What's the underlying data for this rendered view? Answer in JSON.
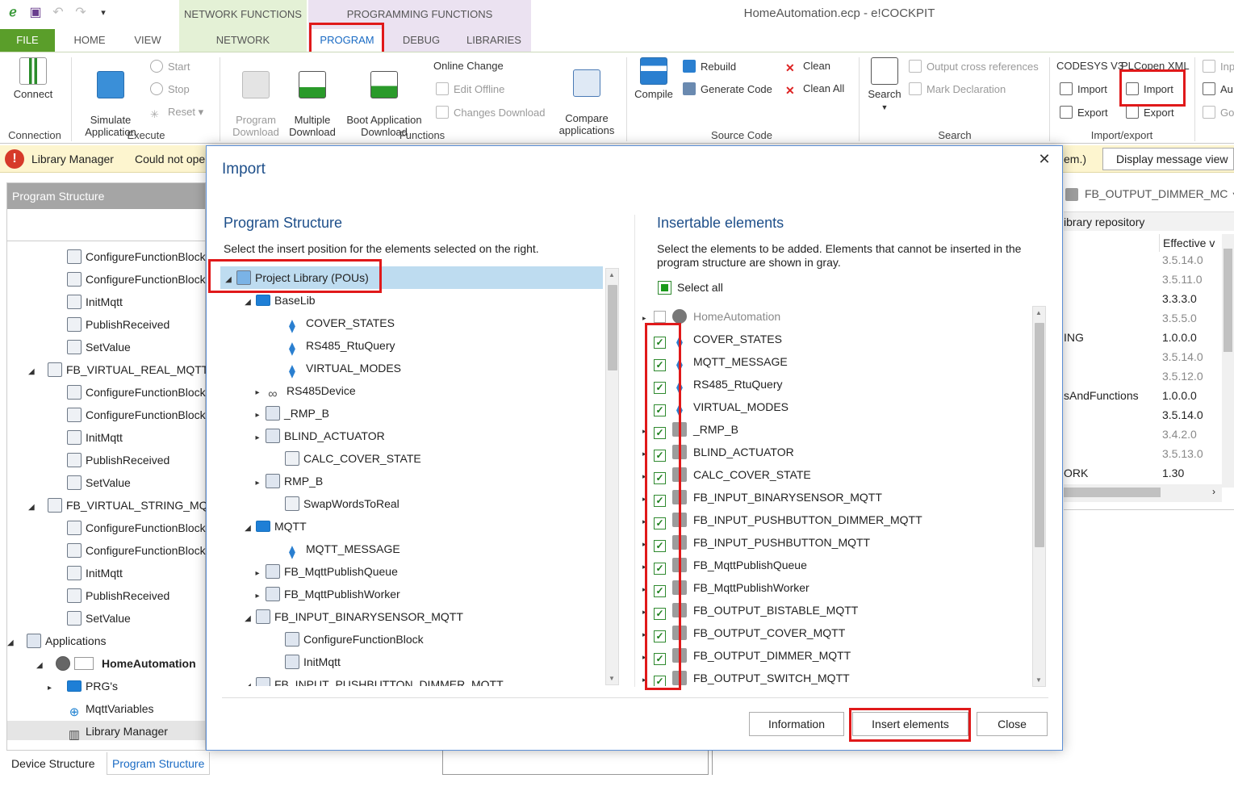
{
  "window": {
    "title": "HomeAutomation.ecp - e!COCKPIT"
  },
  "context_groups": {
    "network_functions": "NETWORK FUNCTIONS",
    "programming_functions": "PROGRAMMING FUNCTIONS"
  },
  "tabs": {
    "file": "FILE",
    "home": "HOME",
    "view": "VIEW",
    "network": "NETWORK",
    "program": "PROGRAM",
    "debug": "DEBUG",
    "libraries": "LIBRARIES"
  },
  "ribbon": {
    "connect": "Connect",
    "simulate": "Simulate\nApplication",
    "start": "Start",
    "stop": "Stop",
    "reset": "Reset",
    "program_download": "Program\nDownload",
    "multiple_download": "Multiple\nDownload",
    "boot_app_download": "Boot Application\nDownload",
    "online_change": "Online Change",
    "edit_offline": "Edit Offline",
    "changes_download": "Changes Download",
    "compare": "Compare\napplications",
    "compile": "Compile",
    "rebuild": "Rebuild",
    "generate_code": "Generate Code",
    "clean": "Clean",
    "clean_all": "Clean All",
    "search": "Search",
    "output_cross_references": "Output cross references",
    "mark_declaration": "Mark Declaration",
    "codesys_v3": "CODESYS V3",
    "plcopen_xml": "PLCopen XML",
    "import1": "Import",
    "export1": "Export",
    "import2": "Import",
    "export2": "Export",
    "ext1": "Inp",
    "ext2": "Au",
    "ext3": "Go",
    "groups": {
      "connection": "Connection",
      "execute": "Execute",
      "functions": "Functions",
      "source_code": "Source Code",
      "search": "Search",
      "import_export": "Import/export"
    }
  },
  "message_bar": {
    "label": "Library Manager",
    "text": "Could not ope",
    "tail": "em.)",
    "button": "Display message view"
  },
  "left_panel": {
    "title": "Program Structure",
    "items": [
      "ConfigureFunctionBlock",
      "ConfigureFunctionBlock",
      "InitMqtt",
      "PublishReceived",
      "SetValue",
      "FB_VIRTUAL_REAL_MQTT",
      "ConfigureFunctionBlock",
      "ConfigureFunctionBlock",
      "InitMqtt",
      "PublishReceived",
      "SetValue",
      "FB_VIRTUAL_STRING_MQ",
      "ConfigureFunctionBlock",
      "ConfigureFunctionBlock",
      "InitMqtt",
      "PublishReceived",
      "SetValue",
      "Applications",
      "HomeAutomation",
      "PRG's",
      "MqttVariables",
      "Library Manager"
    ],
    "bottom_tabs": {
      "device": "Device Structure",
      "program": "Program Structure"
    }
  },
  "right_panel": {
    "header": "FB_OUTPUT_DIMMER_MC",
    "subheader": "ibrary repository",
    "column": "Effective v",
    "rows": [
      {
        "name": "",
        "ver": "3.5.14.0",
        "gray": true
      },
      {
        "name": "",
        "ver": "3.5.11.0",
        "gray": true
      },
      {
        "name": "",
        "ver": "3.3.3.0",
        "gray": false
      },
      {
        "name": "",
        "ver": "3.5.5.0",
        "gray": true
      },
      {
        "name": "ING",
        "ver": "1.0.0.0",
        "gray": false
      },
      {
        "name": "",
        "ver": "3.5.14.0",
        "gray": true
      },
      {
        "name": "",
        "ver": "3.5.12.0",
        "gray": true
      },
      {
        "name": "sAndFunctions",
        "ver": "1.0.0.0",
        "gray": false
      },
      {
        "name": "",
        "ver": "3.5.14.0",
        "gray": false
      },
      {
        "name": "",
        "ver": "3.4.2.0",
        "gray": true
      },
      {
        "name": "",
        "ver": "3.5.13.0",
        "gray": true
      },
      {
        "name": "ORK",
        "ver": "1.30",
        "gray": false
      }
    ]
  },
  "dialog": {
    "title": "Import",
    "left_heading": "Program Structure",
    "left_desc": "Select the insert position for the elements selected on the right.",
    "left_tree": [
      "Project Library (POUs)",
      "BaseLib",
      "COVER_STATES",
      "RS485_RtuQuery",
      "VIRTUAL_MODES",
      "RS485Device",
      "_RMP_B",
      "BLIND_ACTUATOR",
      "CALC_COVER_STATE",
      "RMP_B",
      "SwapWordsToReal",
      "MQTT",
      "MQTT_MESSAGE",
      "FB_MqttPublishQueue",
      "FB_MqttPublishWorker",
      "FB_INPUT_BINARYSENSOR_MQTT",
      "ConfigureFunctionBlock",
      "InitMqtt",
      "FB_INPUT_PUSHBUTTON_DIMMER_MQTT"
    ],
    "right_heading": "Insertable elements",
    "right_desc": "Select the elements to be added. Elements that cannot be inserted in the program structure are shown in gray.",
    "select_all": "Select all",
    "right_tree": [
      "HomeAutomation",
      "COVER_STATES",
      "MQTT_MESSAGE",
      "RS485_RtuQuery",
      "VIRTUAL_MODES",
      "_RMP_B",
      "BLIND_ACTUATOR",
      "CALC_COVER_STATE",
      "FB_INPUT_BINARYSENSOR_MQTT",
      "FB_INPUT_PUSHBUTTON_DIMMER_MQTT",
      "FB_INPUT_PUSHBUTTON_MQTT",
      "FB_MqttPublishQueue",
      "FB_MqttPublishWorker",
      "FB_OUTPUT_BISTABLE_MQTT",
      "FB_OUTPUT_COVER_MQTT",
      "FB_OUTPUT_DIMMER_MQTT",
      "FB_OUTPUT_SWITCH_MQTT"
    ],
    "buttons": {
      "information": "Information",
      "insert": "Insert elements",
      "close": "Close"
    },
    "close_glyph": "✕"
  },
  "colors": {
    "accent_green": "#5a9e2a",
    "highlight_red": "#e0191a",
    "title_blue": "#1e4f8a",
    "selection": "#bedcf0"
  },
  "icons": [
    "save-icon",
    "undo-icon",
    "redo-icon",
    "error-icon",
    "gear-icon",
    "folder-icon",
    "checkbox-icon",
    "close-icon"
  ]
}
